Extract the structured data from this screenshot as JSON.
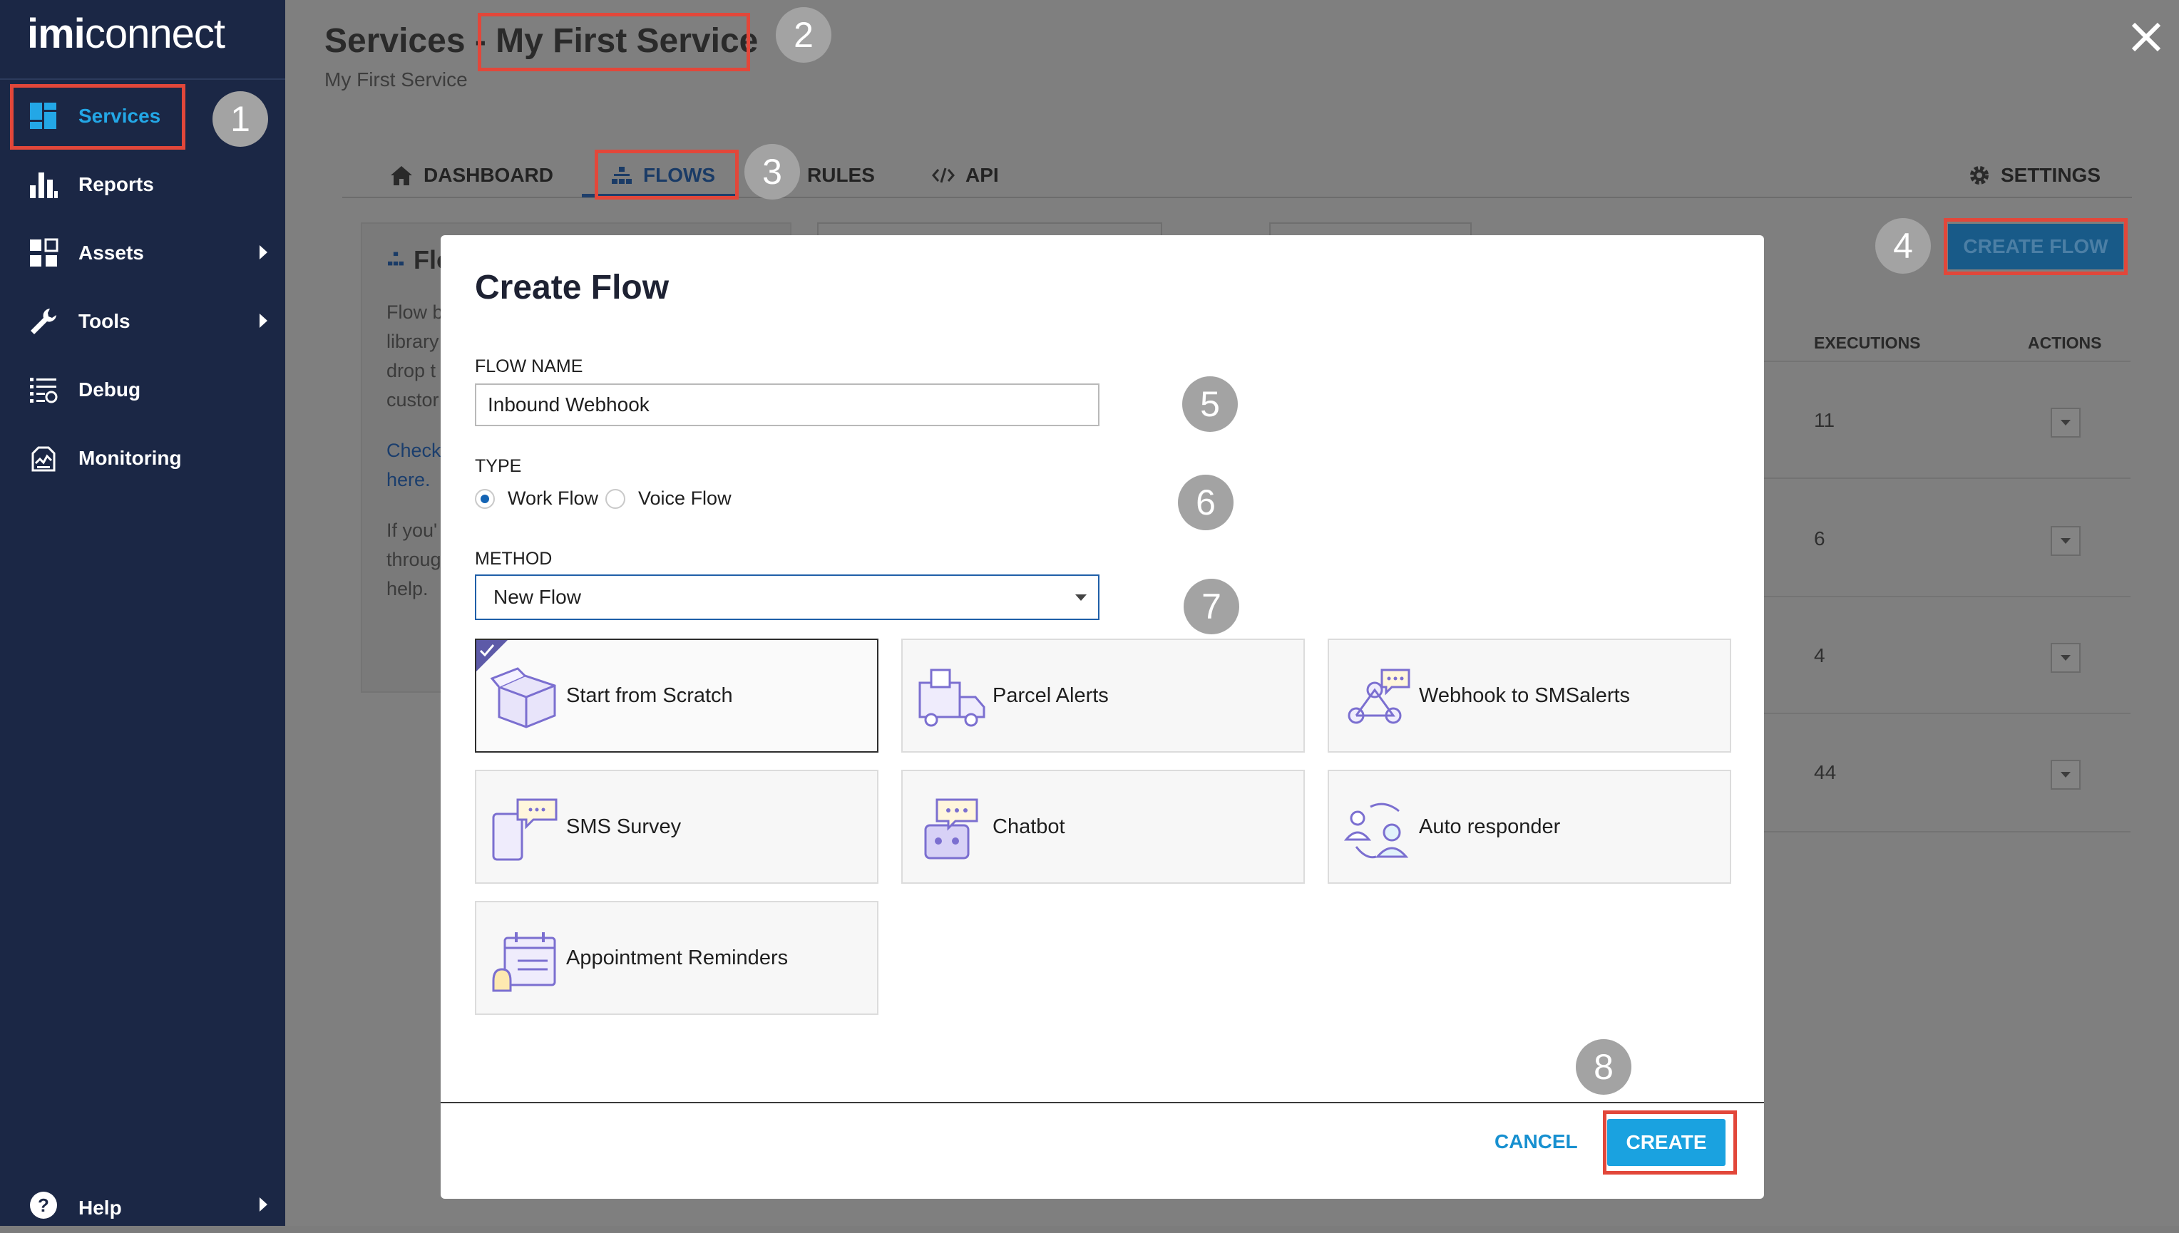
{
  "app": {
    "logo_bold": "imi",
    "logo_rest": "connect"
  },
  "sidebar": {
    "items": [
      {
        "label": "Services",
        "icon": "services-icon",
        "active": true,
        "submenu": false
      },
      {
        "label": "Reports",
        "icon": "bar-chart-icon",
        "active": false,
        "submenu": false
      },
      {
        "label": "Assets",
        "icon": "grid-icon",
        "active": false,
        "submenu": true
      },
      {
        "label": "Tools",
        "icon": "wrench-icon",
        "active": false,
        "submenu": true
      },
      {
        "label": "Debug",
        "icon": "debug-list-icon",
        "active": false,
        "submenu": false
      },
      {
        "label": "Monitoring",
        "icon": "monitor-icon",
        "active": false,
        "submenu": false
      }
    ],
    "help_label": "Help"
  },
  "header": {
    "title_prefix": "Services - ",
    "title_service": "My First Service",
    "subtitle": "My First Service"
  },
  "tabs": [
    {
      "label": "DASHBOARD",
      "icon": "home-icon"
    },
    {
      "label": "FLOWS",
      "icon": "flows-icon",
      "active": true
    },
    {
      "label": "RULES",
      "icon": ""
    },
    {
      "label": "API",
      "icon": "code-icon"
    }
  ],
  "settings_label": "SETTINGS",
  "create_flow_label": "CREATE FLOW",
  "left_card": {
    "title": "Flo",
    "lines": [
      "Flow b",
      "library",
      "drop t",
      "custor"
    ],
    "link_lines": [
      "Check",
      "here."
    ],
    "more_lines": [
      "If you'",
      "throug",
      "help."
    ]
  },
  "table": {
    "headers": [
      "EXECUTIONS",
      "ACTIONS"
    ],
    "executions": [
      "11",
      "6",
      "4",
      "44"
    ]
  },
  "modal": {
    "title": "Create Flow",
    "flow_name_label": "FLOW NAME",
    "flow_name_value": "Inbound Webhook",
    "type_label": "TYPE",
    "type_options": [
      "Work Flow",
      "Voice Flow"
    ],
    "type_selected": "Work Flow",
    "method_label": "METHOD",
    "method_value": "New Flow",
    "templates": [
      {
        "label": "Start from Scratch",
        "icon": "box-icon",
        "selected": true
      },
      {
        "label": "Parcel Alerts",
        "icon": "delivery-truck-icon"
      },
      {
        "label": "Webhook to SMSalerts",
        "icon": "webhook-icon"
      },
      {
        "label": "SMS Survey",
        "icon": "phone-chat-icon"
      },
      {
        "label": "Chatbot",
        "icon": "chatbot-icon"
      },
      {
        "label": "Auto responder",
        "icon": "users-exchange-icon"
      },
      {
        "label": "Appointment Reminders",
        "icon": "calendar-bell-icon"
      }
    ],
    "cancel_label": "CANCEL",
    "create_label": "CREATE"
  },
  "steps": [
    "1",
    "2",
    "3",
    "4",
    "5",
    "6",
    "7",
    "8"
  ],
  "colors": {
    "sidebar_bg": "#1b2745",
    "accent": "#1aa2e0",
    "highlight": "#e2473a",
    "step_badge": "#a3a3a3",
    "template_icon": "#7b6fd0"
  }
}
